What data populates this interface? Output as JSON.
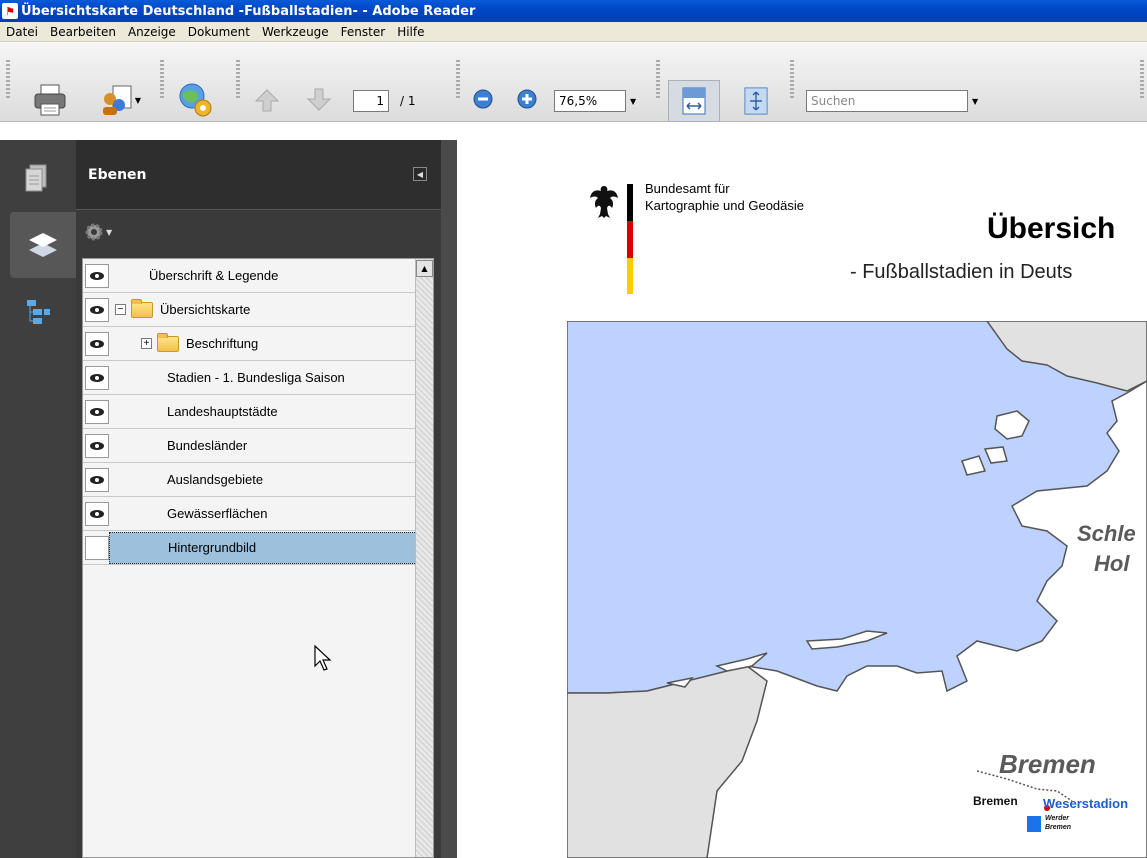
{
  "window": {
    "title": "Übersichtskarte Deutschland -Fußballstadien- - Adobe Reader"
  },
  "menu": [
    "Datei",
    "Bearbeiten",
    "Anzeige",
    "Dokument",
    "Werkzeuge",
    "Fenster",
    "Hilfe"
  ],
  "toolbar": {
    "page_current": "1",
    "page_total": "/ 1",
    "zoom": "76,5%",
    "search_placeholder": "Suchen"
  },
  "panel": {
    "title": "Ebenen"
  },
  "layers": [
    {
      "label": "Überschrift & Legende",
      "visible": true,
      "folder": false,
      "expander": "",
      "indent": 0
    },
    {
      "label": "Übersichtskarte",
      "visible": true,
      "folder": true,
      "expander": "−",
      "indent": 0
    },
    {
      "label": "Beschriftung",
      "visible": true,
      "folder": true,
      "expander": "+",
      "indent": 1
    },
    {
      "label": "Stadien - 1. Bundesliga Saison",
      "visible": true,
      "folder": false,
      "expander": "",
      "indent": 2
    },
    {
      "label": "Landeshauptstädte",
      "visible": true,
      "folder": false,
      "expander": "",
      "indent": 2
    },
    {
      "label": "Bundesländer",
      "visible": true,
      "folder": false,
      "expander": "",
      "indent": 2
    },
    {
      "label": "Auslandsgebiete",
      "visible": true,
      "folder": false,
      "expander": "",
      "indent": 2
    },
    {
      "label": "Gewässerflächen",
      "visible": true,
      "folder": false,
      "expander": "",
      "indent": 2
    },
    {
      "label": "Hintergrundbild",
      "visible": false,
      "folder": false,
      "expander": "",
      "indent": 2,
      "selected": true
    }
  ],
  "document": {
    "agency_line1": "Bundesamt für",
    "agency_line2": "Kartographie und Geodäsie",
    "title": "Übersich",
    "subtitle": "- Fußballstadien in Deuts",
    "map_labels": {
      "state1_line1": "Schle",
      "state1_line2": "Hol",
      "state2": "Bremen",
      "city": "Bremen",
      "stadium": "Weserstadion",
      "club_line1": "Werder",
      "club_line2": "Bremen"
    }
  },
  "colors": {
    "water": "#bed2ff",
    "land": "#ffffff",
    "foreign": "#e1e1e1",
    "selection": "#9dc0dd",
    "titlebar": "#0a5bd9"
  }
}
